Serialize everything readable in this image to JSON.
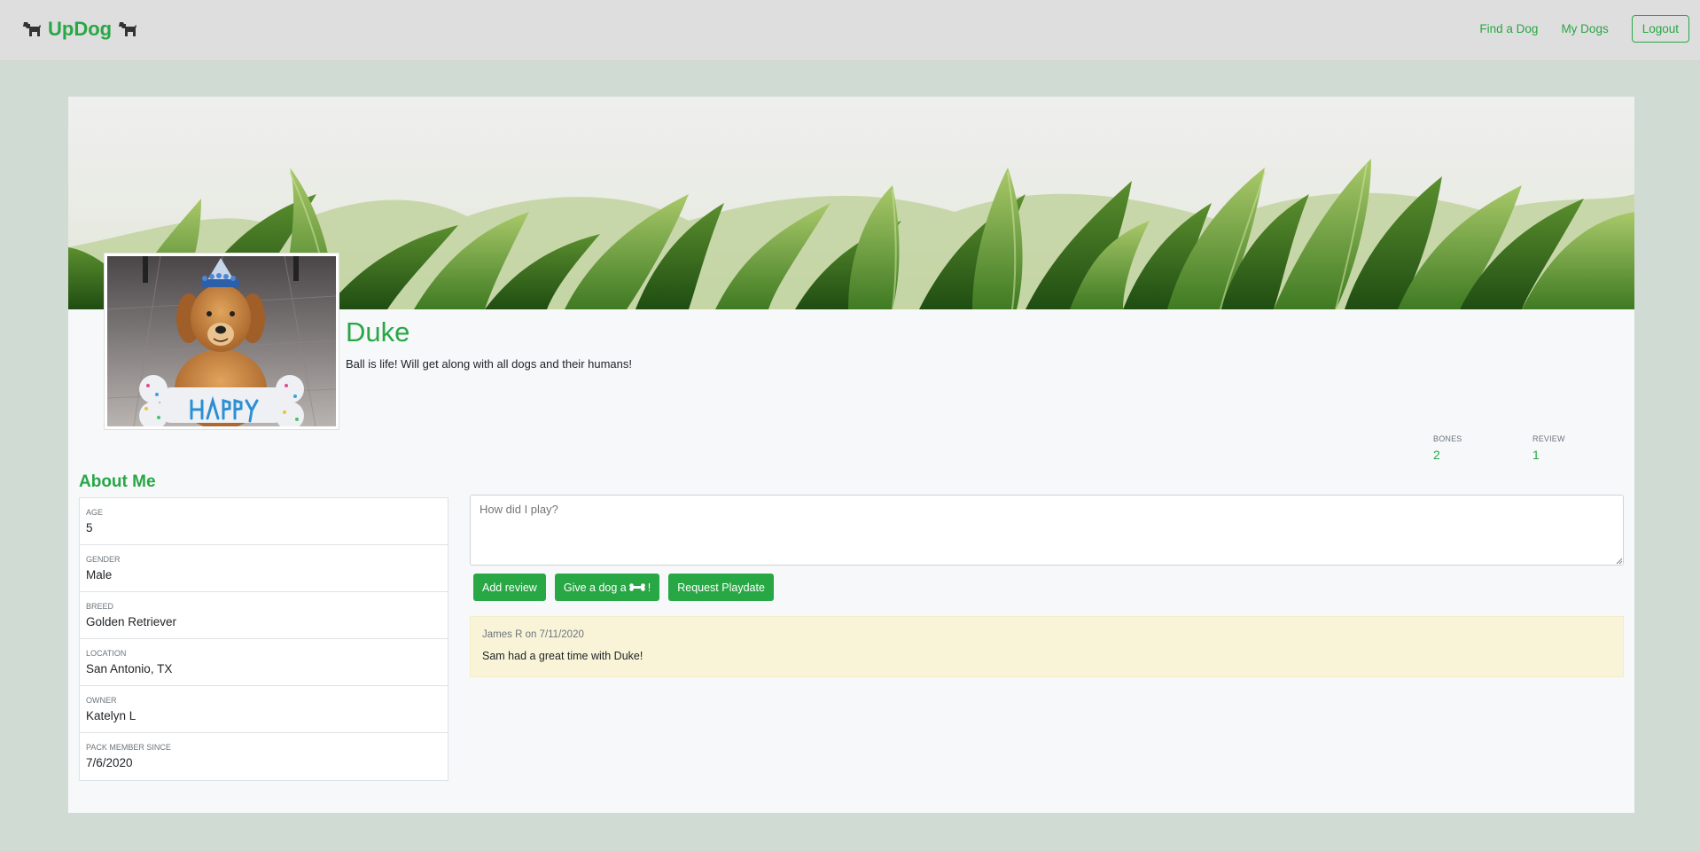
{
  "nav": {
    "brand": "UpDog",
    "links": [
      "Find a Dog",
      "My Dogs"
    ],
    "logout": "Logout"
  },
  "profile": {
    "name": "Duke",
    "bio": "Ball is life! Will get along with all dogs and their humans!",
    "stats": [
      {
        "label": "Bones",
        "value": "2"
      },
      {
        "label": "Review",
        "value": "1"
      }
    ]
  },
  "about": {
    "title": "About Me",
    "items": [
      {
        "label": "Age",
        "value": "5"
      },
      {
        "label": "Gender",
        "value": "Male"
      },
      {
        "label": "Breed",
        "value": "Golden Retriever"
      },
      {
        "label": "Location",
        "value": "San Antonio, TX"
      },
      {
        "label": "Owner",
        "value": "Katelyn L"
      },
      {
        "label": "Pack Member Since",
        "value": "7/6/2020"
      }
    ]
  },
  "review_form": {
    "placeholder": "How did I play?",
    "add_review": "Add review",
    "give_bone_prefix": "Give a dog a",
    "give_bone_suffix": "!",
    "request_playdate": "Request Playdate"
  },
  "reviews": [
    {
      "meta": "James R on 7/11/2020",
      "text": "Sam had a great time with Duke!"
    }
  ],
  "colors": {
    "accent": "#28a745",
    "page_bg": "#d0dbd3",
    "navbar_bg": "#dedede",
    "review_bg": "#f9f4d8"
  },
  "icons": {
    "brand_left": "dog-icon",
    "brand_right": "dog-icon",
    "bone": "bone-icon",
    "avatar": "dog-photo",
    "cover": "grass-cover-photo"
  }
}
